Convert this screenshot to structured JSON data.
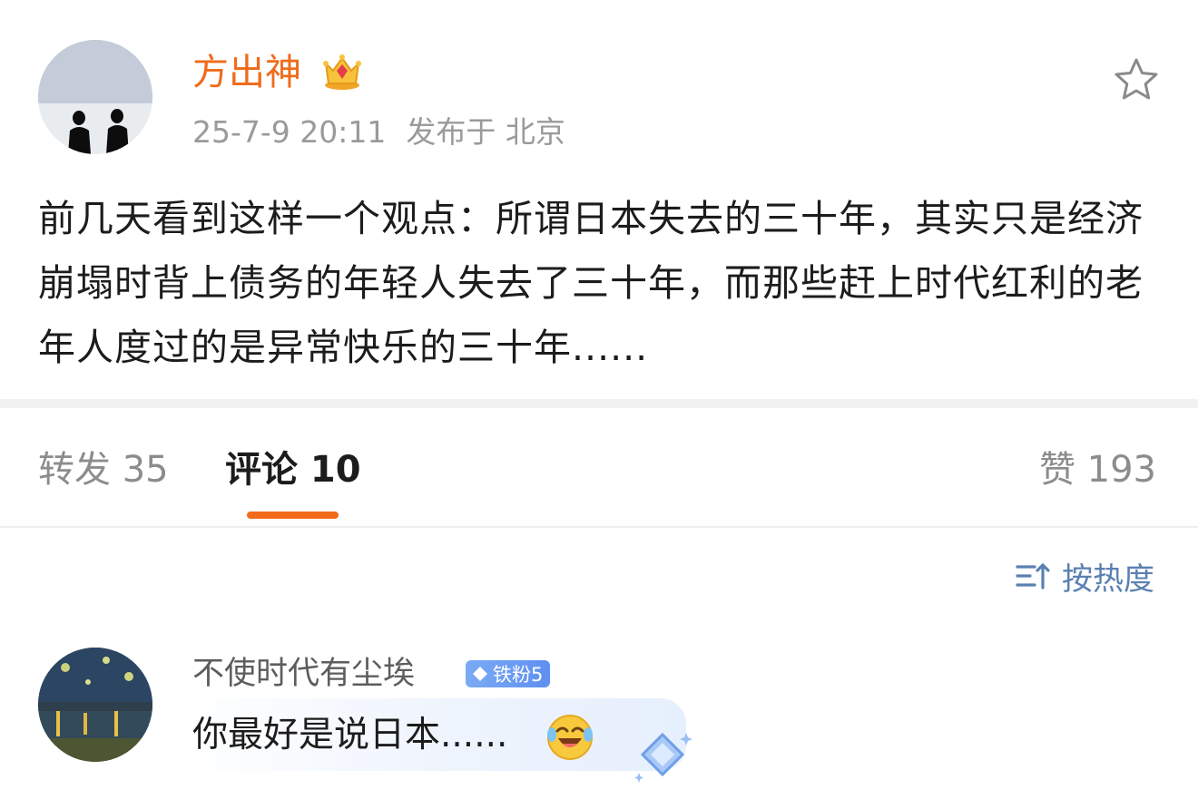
{
  "post": {
    "author": "方出神",
    "time": "25-7-9 20:11",
    "location": "发布于 北京",
    "body": "前几天看到这样一个观点：所谓日本失去的三十年，其实只是经济崩塌时背上债务的年轻人失去了三十年，而那些赶上时代红利的老年人度过的是异常快乐的三十年......",
    "icons": {
      "badge": "crown-icon",
      "favorite": "star-icon"
    }
  },
  "tabs": {
    "repost": "转发 35",
    "comments": "评论 10",
    "likes": "赞 193",
    "active": "comments"
  },
  "sort": {
    "label": "按热度",
    "icon": "sort-icon"
  },
  "comments": [
    {
      "user": "不使时代有尘埃",
      "badge": "铁粉5",
      "text": "你最好是说日本......",
      "emoji": "laughing-crying-emoji",
      "decoration": "gem-icon"
    }
  ],
  "colors": {
    "author_name": "#ef6b1a",
    "tab_indicator": "#f26a1c",
    "sort_link": "#5b80b2",
    "badge_bg": "#6d9cf3",
    "meta_text": "#9a9a9a"
  }
}
